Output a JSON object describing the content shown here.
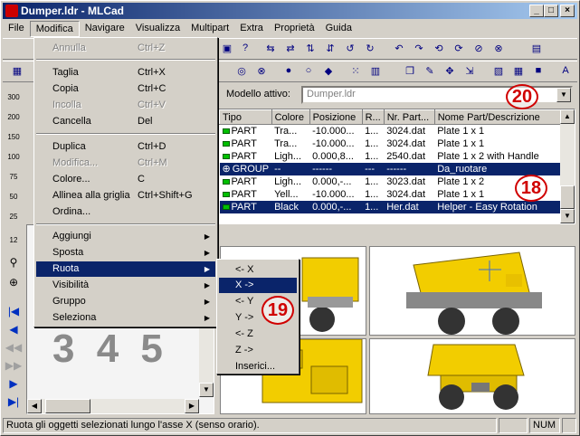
{
  "window": {
    "title": "Dumper.ldr - MLCad",
    "minimize": "_",
    "maximize": "□",
    "close": "×"
  },
  "menubar": [
    "File",
    "Modifica",
    "Navigare",
    "Visualizza",
    "Multipart",
    "Extra",
    "Proprietà",
    "Guida"
  ],
  "modello": {
    "label": "Modello attivo:",
    "value": "Dumper.ldr"
  },
  "table": {
    "headers": [
      "Tipo",
      "Colore",
      "Posizione",
      "R...",
      "Nr. Part...",
      "Nome Part/Descrizione"
    ],
    "rows": [
      [
        "PART",
        "Tra...",
        "-10.000...",
        "1...",
        "3024.dat",
        "Plate  1 x 1"
      ],
      [
        "PART",
        "Tra...",
        "-10.000...",
        "1...",
        "3024.dat",
        "Plate  1 x 1"
      ],
      [
        "PART",
        "Ligh...",
        "0.000,8...",
        "1...",
        "2540.dat",
        "Plate  1 x 2 with Handle"
      ],
      [
        "GROUP",
        "--",
        "------",
        "---",
        "------",
        "Da_ruotare"
      ],
      [
        "PART",
        "Ligh...",
        "0.000,-...",
        "1...",
        "3023.dat",
        "Plate  1 x 2"
      ],
      [
        "PART",
        "Yell...",
        "-10.000...",
        "1...",
        "3024.dat",
        "Plate  1 x 1"
      ],
      [
        "PART",
        "Black",
        "0.000,-...",
        "1...",
        "Her.dat",
        "Helper - Easy Rotation"
      ]
    ]
  },
  "modifica_menu": [
    {
      "label": "Annulla",
      "accel": "Ctrl+Z",
      "disabled": true
    },
    {
      "label": "Taglia",
      "accel": "Ctrl+X"
    },
    {
      "label": "Copia",
      "accel": "Ctrl+C"
    },
    {
      "label": "Incolla",
      "accel": "Ctrl+V",
      "disabled": true
    },
    {
      "label": "Cancella",
      "accel": "Del"
    },
    {
      "label": "Duplica",
      "accel": "Ctrl+D"
    },
    {
      "label": "Modifica...",
      "accel": "Ctrl+M",
      "disabled": true
    },
    {
      "label": "Colore...",
      "accel": "C"
    },
    {
      "label": "Allinea alla griglia",
      "accel": "Ctrl+Shift+G"
    },
    {
      "label": "Ordina..."
    },
    {
      "label": "Aggiungi",
      "sub": true
    },
    {
      "label": "Sposta",
      "sub": true
    },
    {
      "label": "Ruota",
      "sub": true
    },
    {
      "label": "Visibilità",
      "sub": true
    },
    {
      "label": "Gruppo",
      "sub": true
    },
    {
      "label": "Seleziona",
      "sub": true
    }
  ],
  "ruota_menu": [
    "<- X",
    "X ->",
    "<- Y",
    "Y ->",
    "<- Z",
    "Z ->",
    "Inserici..."
  ],
  "vtb_labels": [
    "300",
    "200",
    "150",
    "100",
    "75",
    "50",
    "25",
    "12"
  ],
  "left_digits": "3 4 5",
  "callouts": [
    "18",
    "19",
    "20"
  ],
  "status": {
    "text": "Ruota gli oggetti selezionati lungo l'asse X (senso orario).",
    "num": "NUM"
  },
  "colors": {
    "titlebar": "#0a246a",
    "selection": "#0a246a",
    "callout": "#d00000",
    "lego_yellow": "#f2cd00"
  }
}
